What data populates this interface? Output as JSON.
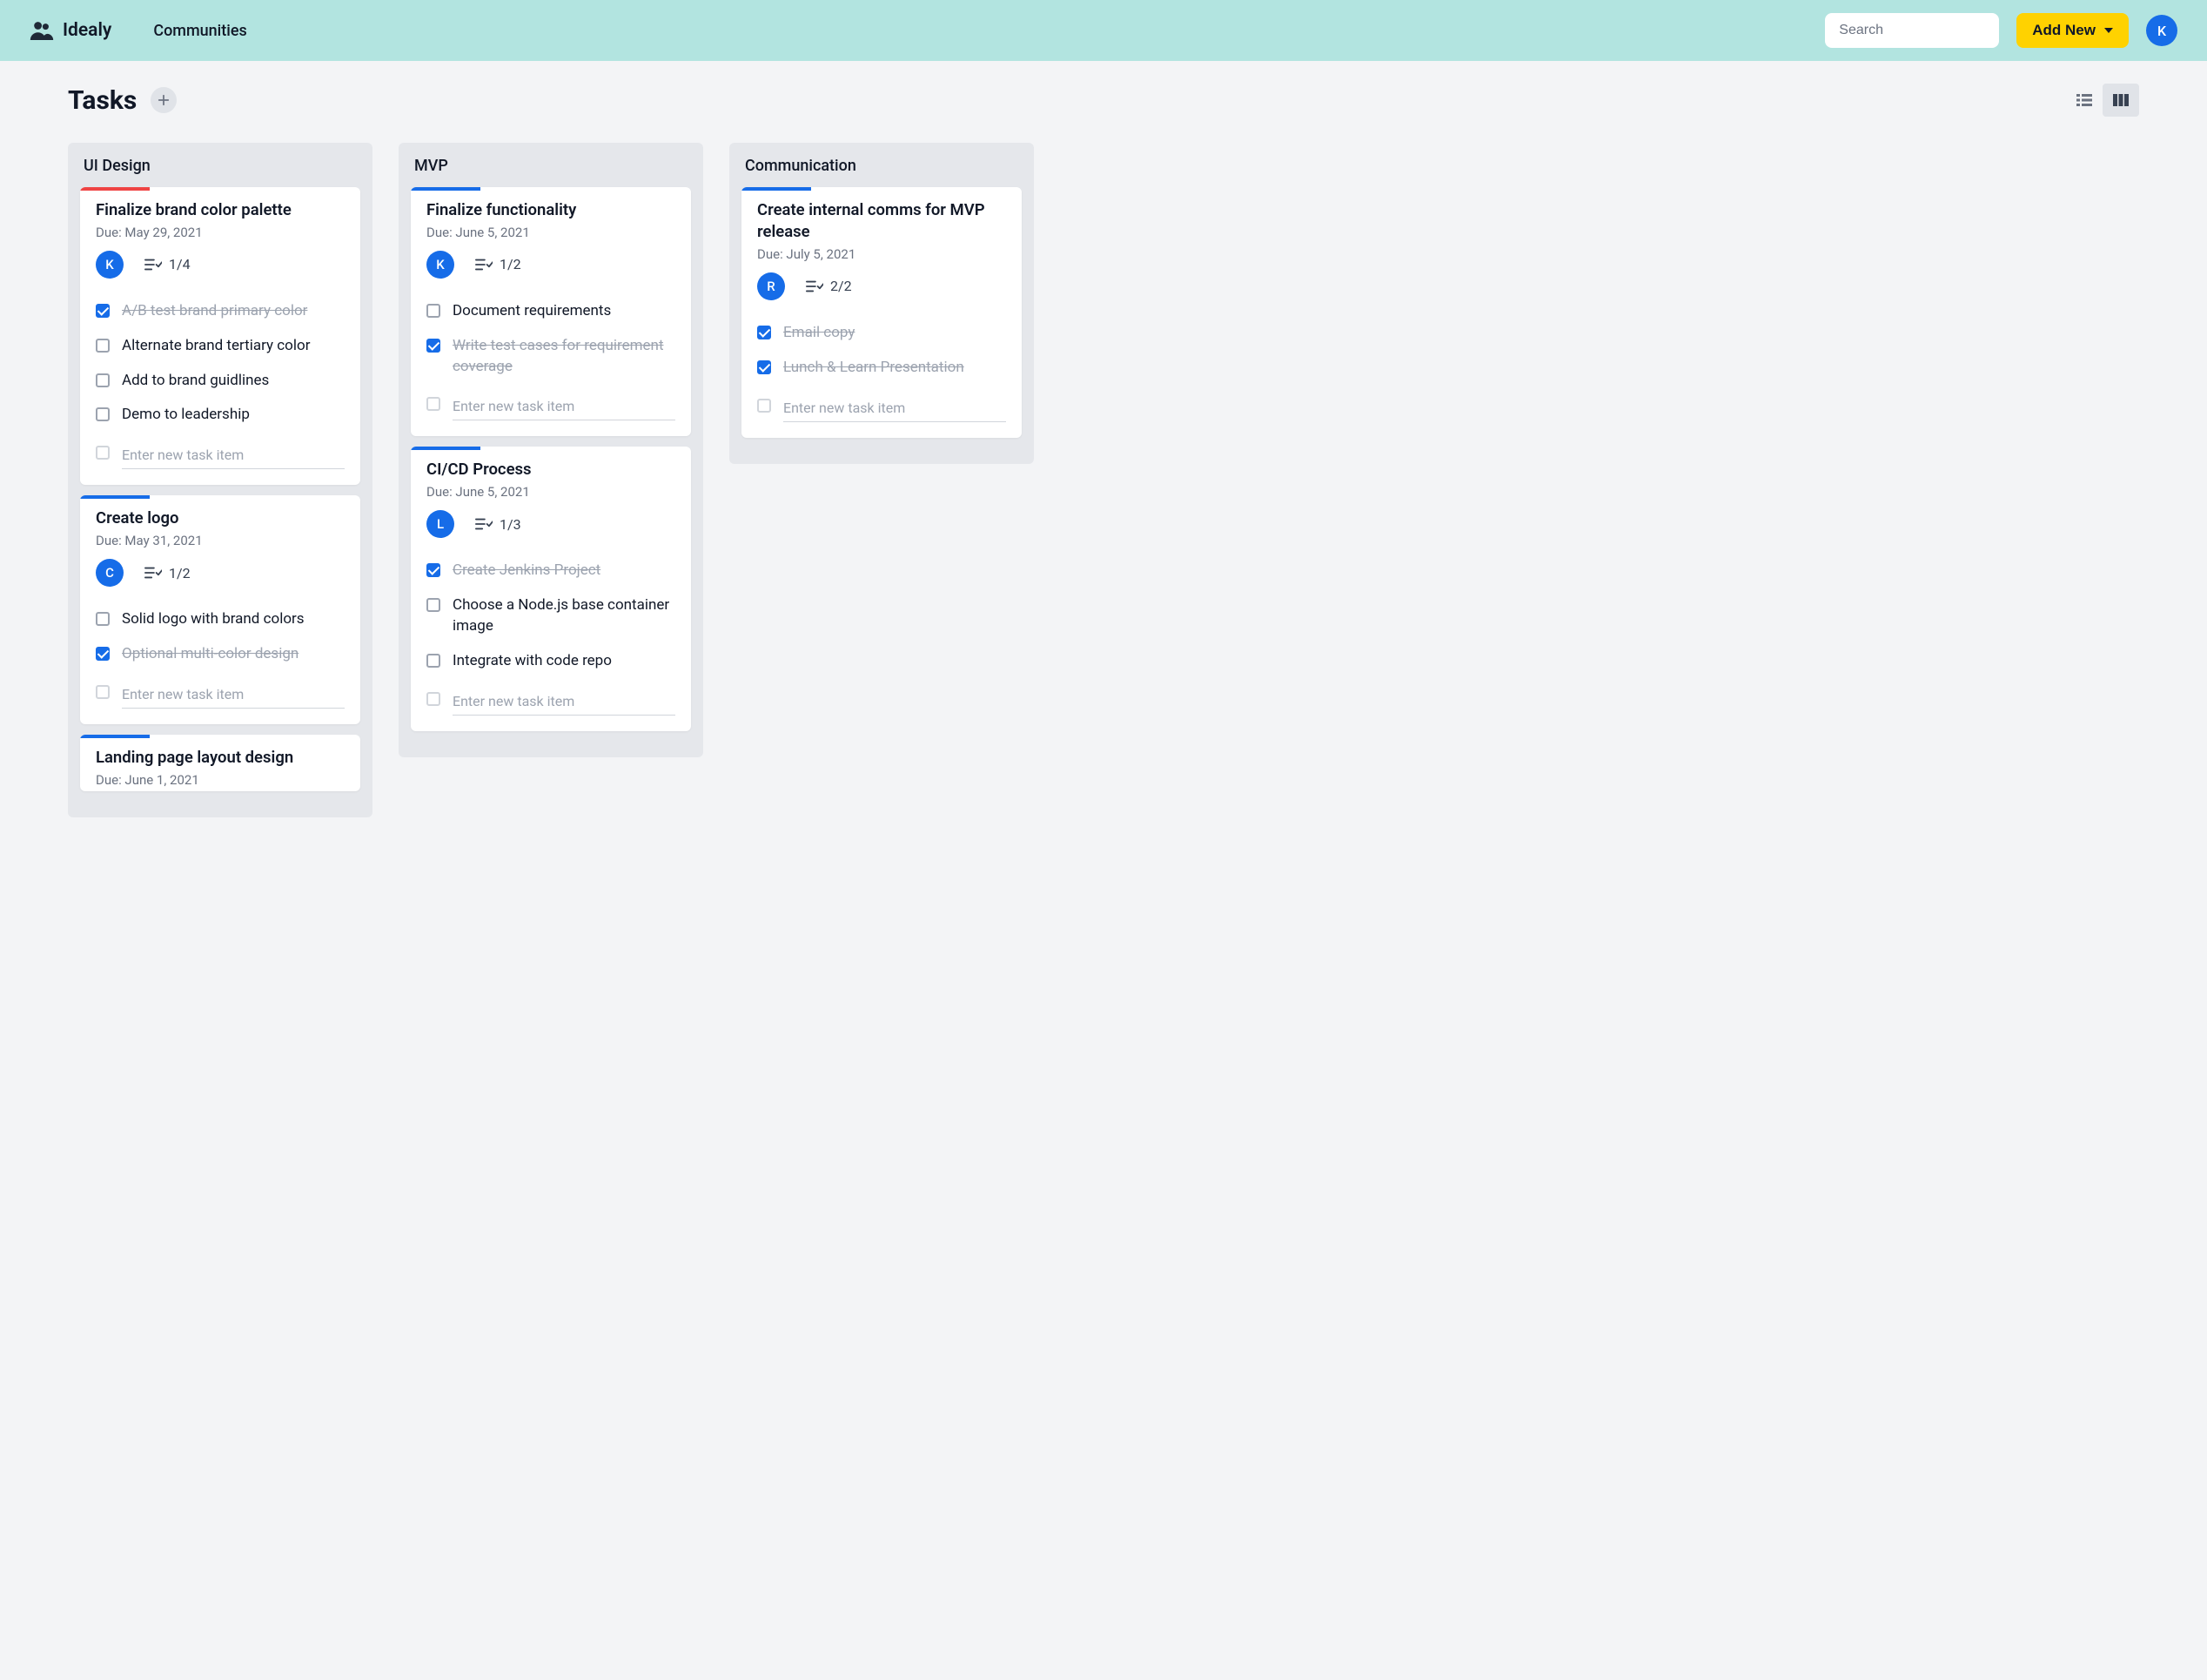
{
  "header": {
    "app_name": "Idealy",
    "nav_communities": "Communities",
    "search_placeholder": "Search",
    "add_new_label": "Add New",
    "avatar_initial": "K"
  },
  "page": {
    "title": "Tasks",
    "add_tooltip": "+",
    "new_item_placeholder": "Enter new task item"
  },
  "columns": [
    {
      "title": "UI Design",
      "cards": [
        {
          "accent": "red",
          "title": "Finalize brand color palette",
          "due": "Due: May 29, 2021",
          "avatar": "K",
          "progress": "1/4",
          "items": [
            {
              "label": "A/B test brand primary color",
              "done": true
            },
            {
              "label": "Alternate brand tertiary color",
              "done": false
            },
            {
              "label": "Add to brand guidlines",
              "done": false
            },
            {
              "label": "Demo to leadership",
              "done": false
            }
          ],
          "show_new_item": true,
          "truncated": false
        },
        {
          "accent": "blue",
          "title": "Create logo",
          "due": "Due: May 31, 2021",
          "avatar": "C",
          "progress": "1/2",
          "items": [
            {
              "label": "Solid logo with brand colors",
              "done": false
            },
            {
              "label": "Optional multi-color design",
              "done": true
            }
          ],
          "show_new_item": true,
          "truncated": false
        },
        {
          "accent": "blue",
          "title": "Landing page layout design",
          "due": "Due: June 1, 2021",
          "avatar": null,
          "progress": null,
          "items": [],
          "show_new_item": false,
          "truncated": true
        }
      ]
    },
    {
      "title": "MVP",
      "cards": [
        {
          "accent": "blue",
          "title": "Finalize functionality",
          "due": "Due: June 5, 2021",
          "avatar": "K",
          "progress": "1/2",
          "items": [
            {
              "label": "Document requirements",
              "done": false
            },
            {
              "label": "Write test cases for requirement coverage",
              "done": true
            }
          ],
          "show_new_item": true,
          "truncated": false
        },
        {
          "accent": "blue",
          "title": "CI/CD Process",
          "due": "Due: June 5, 2021",
          "avatar": "L",
          "progress": "1/3",
          "items": [
            {
              "label": "Create Jenkins Project",
              "done": true
            },
            {
              "label": "Choose a Node.js base container image",
              "done": false
            },
            {
              "label": "Integrate with code repo",
              "done": false
            }
          ],
          "show_new_item": true,
          "truncated": false
        }
      ]
    },
    {
      "title": "Communication",
      "cards": [
        {
          "accent": "blue",
          "title": "Create internal comms for MVP release",
          "due": "Due: July 5, 2021",
          "avatar": "R",
          "progress": "2/2",
          "items": [
            {
              "label": "Email copy",
              "done": true
            },
            {
              "label": "Lunch & Learn Presentation",
              "done": true
            }
          ],
          "show_new_item": true,
          "truncated": false
        }
      ]
    }
  ]
}
